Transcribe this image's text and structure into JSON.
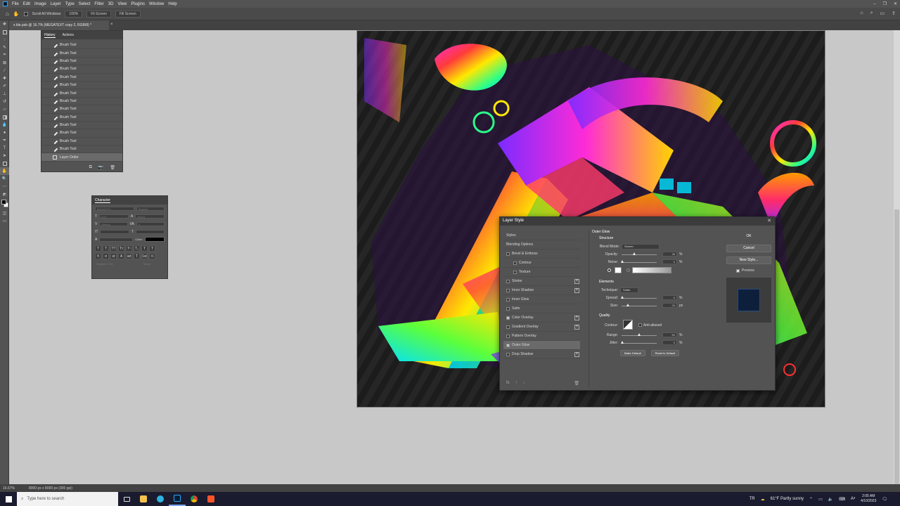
{
  "menubar": {
    "items": [
      "File",
      "Edit",
      "Image",
      "Layer",
      "Type",
      "Select",
      "Filter",
      "3D",
      "View",
      "Plugins",
      "Window",
      "Help"
    ],
    "controls": [
      "–",
      "❐",
      "✕"
    ]
  },
  "options_bar": {
    "scroll_all_label": "Scroll All Windows",
    "zoom_100_label": "100%",
    "fit_screen_label": "Fit Screen",
    "fill_screen_label": "Fill Screen",
    "right_icons": [
      "⌂",
      "⌕",
      "▭",
      "⇪"
    ]
  },
  "document": {
    "tab_title": "s ble.psb @ 16.7% (MEGATEXT copy 2, RGB/8) *",
    "tab_close": "×"
  },
  "history_panel": {
    "tabs": [
      "History",
      "Actions"
    ],
    "items": [
      "Brush Tool",
      "Brush Tool",
      "Brush Tool",
      "Brush Tool",
      "Brush Tool",
      "Brush Tool",
      "Brush Tool",
      "Brush Tool",
      "Brush Tool",
      "Brush Tool",
      "Brush Tool",
      "Brush Tool",
      "Brush Tool",
      "Brush Tool"
    ],
    "selected": "Layer Order",
    "footer_icons": [
      "⧉",
      "📷",
      "🗑"
    ]
  },
  "character_panel": {
    "title": "Character",
    "font_family": "Myriad Pro",
    "font_style": "Regular",
    "size": "8 pt",
    "leading": "(Auto)",
    "tracking": "Metrics",
    "kerning": "0",
    "color_label": "Color:",
    "style_buttons": [
      "T",
      "T",
      "TT",
      "Tт",
      "T¹",
      "T₁",
      "T",
      "T"
    ],
    "ot_buttons": [
      "fi",
      "σ",
      "st",
      "A",
      "ad",
      "T",
      "1st",
      "½"
    ],
    "language": "English: USA",
    "aa": "Sharp"
  },
  "layer_style_dialog": {
    "title": "Layer Style",
    "close": "✕",
    "styles_header": "Styles",
    "blending_options": "Blending Options",
    "effects": [
      {
        "label": "Bevel & Emboss",
        "checked": false,
        "plus": false,
        "indent": false
      },
      {
        "label": "Contour",
        "checked": false,
        "plus": false,
        "indent": true
      },
      {
        "label": "Texture",
        "checked": false,
        "plus": false,
        "indent": true
      },
      {
        "label": "Stroke",
        "checked": false,
        "plus": true,
        "indent": false
      },
      {
        "label": "Inner Shadow",
        "checked": false,
        "plus": true,
        "indent": false
      },
      {
        "label": "Inner Glow",
        "checked": false,
        "plus": false,
        "indent": false
      },
      {
        "label": "Satin",
        "checked": false,
        "plus": false,
        "indent": false
      },
      {
        "label": "Color Overlay",
        "checked": true,
        "plus": true,
        "indent": false
      },
      {
        "label": "Gradient Overlay",
        "checked": false,
        "plus": true,
        "indent": false
      },
      {
        "label": "Pattern Overlay",
        "checked": false,
        "plus": false,
        "indent": false
      },
      {
        "label": "Outer Glow",
        "checked": true,
        "plus": false,
        "indent": false,
        "selected": true
      },
      {
        "label": "Drop Shadow",
        "checked": false,
        "plus": true,
        "indent": false
      }
    ],
    "footer_icons": [
      "fx",
      "↑",
      "↓",
      "🗑"
    ],
    "outer_glow": {
      "title": "Outer Glow",
      "structure": "Structure",
      "blend_mode_label": "Blend Mode:",
      "blend_mode": "Screen",
      "opacity_label": "Opacity:",
      "opacity": "35",
      "noise_label": "Noise:",
      "noise": "0",
      "elements": "Elements",
      "technique_label": "Technique:",
      "technique": "Softer",
      "spread_label": "Spread:",
      "spread": "0",
      "size_label": "Size:",
      "size": "29",
      "quality": "Quality",
      "contour_label": "Contour:",
      "anti_aliased_label": "Anti-aliased",
      "range_label": "Range:",
      "range": "50",
      "jitter_label": "Jitter:",
      "jitter": "0",
      "pct": "%",
      "px": "px",
      "make_default": "Make Default",
      "reset_default": "Reset to Default",
      "glow_color": "#ffffff"
    },
    "buttons": {
      "ok": "OK",
      "cancel": "Cancel",
      "new_style": "New Style...",
      "preview": "Preview"
    }
  },
  "status_bar": {
    "zoom": "16.67%",
    "doc_info": "8000 px x 8000 px (300 ppi)"
  },
  "taskbar": {
    "search_placeholder": "Type here to search",
    "lang": "TR",
    "weather": "61°F  Partly sunny",
    "time": "2:05 AM",
    "date": "4/10/2023"
  },
  "colors": {
    "accent": "#31a8ff",
    "panel": "#535353",
    "dialog_title": "#3c3c3c"
  }
}
